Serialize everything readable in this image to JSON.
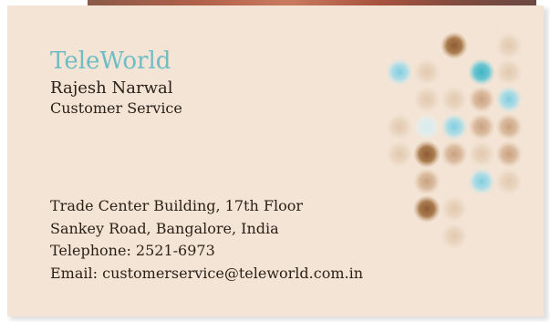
{
  "card": {
    "company": "TeleWorld",
    "name": "Rajesh Narwal",
    "title": "Customer Service",
    "address_lines": [
      "Trade Center Building, 17th Floor",
      "Sankey Road, Bangalore, India",
      "Telephone: 2521-6973",
      "Email: customerservice@teleworld.com.in"
    ]
  },
  "colors": {
    "card_background": "#f3e4d5",
    "company_text": "#6fbdc4",
    "body_text": "#2b2119"
  }
}
